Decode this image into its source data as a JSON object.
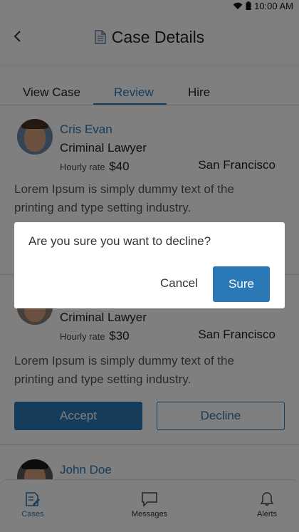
{
  "status_bar": {
    "time": "10:00 AM"
  },
  "header": {
    "title": "Case Details"
  },
  "tabs": [
    {
      "label": "View Case",
      "active": false
    },
    {
      "label": "Review",
      "active": true
    },
    {
      "label": "Hire",
      "active": false
    }
  ],
  "lawyers": [
    {
      "name": "Cris Evan",
      "role": "Criminal Lawyer",
      "rate_label": "Hourly rate",
      "rate_value": "$40",
      "city": "San Francisco",
      "description": "Lorem Ipsum is simply dummy text of the printing and type setting industry."
    },
    {
      "name": "",
      "role": "Criminal Lawyer",
      "rate_label": "Hourly rate",
      "rate_value": "$30",
      "city": "San Francisco",
      "description": "Lorem Ipsum is simply dummy text of the printing and type setting industry.",
      "accept_label": "Accept",
      "decline_label": "Decline"
    },
    {
      "name": "John Doe"
    }
  ],
  "bottom_nav": [
    {
      "label": "Cases",
      "icon": "cases-icon",
      "active": true
    },
    {
      "label": "Messages",
      "icon": "messages-icon",
      "active": false
    },
    {
      "label": "Alerts",
      "icon": "bell-icon",
      "active": false
    }
  ],
  "dialog": {
    "message": "Are you sure you want to decline?",
    "cancel_label": "Cancel",
    "sure_label": "Sure"
  },
  "colors": {
    "accent": "#2a78b5",
    "overlay": "rgba(0,0,0,0.5)"
  }
}
